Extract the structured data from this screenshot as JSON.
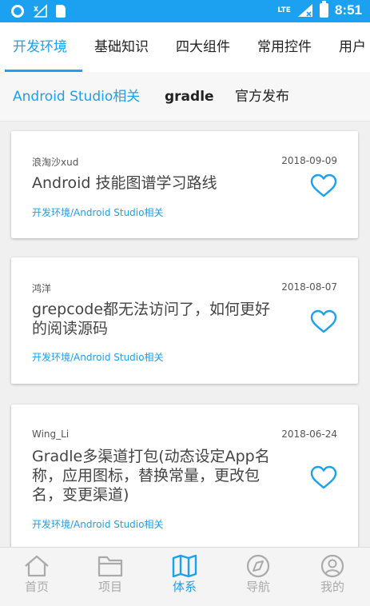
{
  "status_bar": {
    "time": "8:51",
    "network": "LTE"
  },
  "primary_tabs": [
    {
      "label": "开发环境",
      "active": true
    },
    {
      "label": "基础知识",
      "active": false
    },
    {
      "label": "四大组件",
      "active": false
    },
    {
      "label": "常用控件",
      "active": false
    },
    {
      "label": "用户",
      "active": false
    }
  ],
  "secondary_tabs": [
    {
      "label": "Android Studio相关",
      "active": true
    },
    {
      "label": "gradle",
      "active": false
    },
    {
      "label": "官方发布",
      "active": false
    }
  ],
  "articles": [
    {
      "author": "浪淘沙xud",
      "date": "2018-09-09",
      "title": "Android 技能图谱学习路线",
      "chapter": "开发环境/Android Studio相关"
    },
    {
      "author": "鸿洋",
      "date": "2018-08-07",
      "title": "grepcode都无法访问了，如何更好的阅读源码",
      "chapter": "开发环境/Android Studio相关"
    },
    {
      "author": "Wing_Li",
      "date": "2018-06-24",
      "title": "Gradle多渠道打包(动态设定App名称，应用图标，替换常量，更改包名，变更渠道)",
      "chapter": "开发环境/Android Studio相关"
    }
  ],
  "bottom_nav": [
    {
      "label": "首页",
      "icon": "home-icon",
      "active": false
    },
    {
      "label": "项目",
      "icon": "folder-icon",
      "active": false
    },
    {
      "label": "体系",
      "icon": "map-icon",
      "active": true
    },
    {
      "label": "导航",
      "icon": "compass-icon",
      "active": false
    },
    {
      "label": "我的",
      "icon": "person-icon",
      "active": false
    }
  ],
  "colors": {
    "accent": "#1ba1f0",
    "status_bar": "#1ba1f0",
    "text_dark": "#444444",
    "nav_inactive": "#aaaaaa"
  }
}
